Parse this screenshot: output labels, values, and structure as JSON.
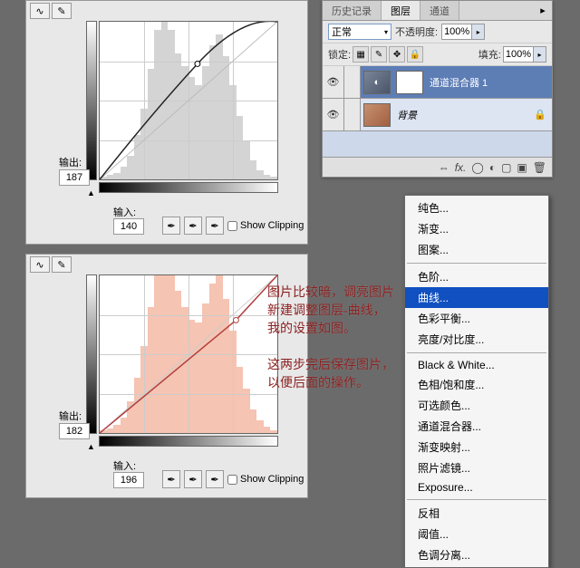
{
  "curves1": {
    "output_label": "输出:",
    "output_value": "187",
    "input_label": "输入:",
    "input_value": "140",
    "show_clipping": "Show Clipping",
    "chart_data": {
      "type": "histogram-curve",
      "x_range": [
        0,
        255
      ],
      "y_range": [
        0,
        255
      ],
      "curve_points": [
        [
          0,
          0
        ],
        [
          140,
          187
        ],
        [
          255,
          255
        ]
      ],
      "histogram_shape": [
        2,
        3,
        4,
        8,
        15,
        28,
        45,
        70,
        95,
        110,
        95,
        80,
        72,
        65,
        60,
        72,
        85,
        92,
        78,
        60,
        40,
        25,
        12,
        6,
        3,
        2
      ]
    }
  },
  "curves2": {
    "output_label": "输出:",
    "output_value": "182",
    "input_label": "输入:",
    "input_value": "196",
    "show_clipping": "Show Clipping",
    "chart_data": {
      "type": "histogram-curve",
      "x_range": [
        0,
        255
      ],
      "y_range": [
        0,
        255
      ],
      "curve_points": [
        [
          0,
          0
        ],
        [
          196,
          182
        ],
        [
          255,
          255
        ]
      ],
      "histogram_shape": [
        2,
        3,
        5,
        10,
        20,
        35,
        55,
        80,
        100,
        115,
        105,
        90,
        80,
        72,
        70,
        82,
        95,
        100,
        85,
        65,
        42,
        28,
        15,
        8,
        4,
        2
      ]
    }
  },
  "layers": {
    "tabs": [
      "历史记录",
      "图层",
      "通道"
    ],
    "active_tab": 1,
    "blend_mode": "正常",
    "opacity_label": "不透明度:",
    "opacity_value": "100%",
    "lock_label": "锁定:",
    "fill_label": "填充:",
    "fill_value": "100%",
    "rows": [
      {
        "name": "通道混合器 1",
        "selected": true,
        "has_mask": true
      },
      {
        "name": "背景",
        "selected": false,
        "has_mask": false,
        "italic": true
      }
    ]
  },
  "menu": {
    "items": [
      "纯色...",
      "渐变...",
      "图案...",
      "-",
      "色阶...",
      "曲线...",
      "色彩平衡...",
      "亮度/对比度...",
      "-",
      "Black & White...",
      "色相/饱和度...",
      "可选颜色...",
      "通道混合器...",
      "渐变映射...",
      "照片滤镜...",
      "Exposure...",
      "-",
      "反相",
      "阈值...",
      "色调分离..."
    ],
    "highlight_index": 5
  },
  "anno": {
    "text1": "图片比较暗，调亮图片\n新建调整图层-曲线，\n我的设置如图。",
    "text2": "这两步完后保存图片，\n以便后面的操作。"
  }
}
